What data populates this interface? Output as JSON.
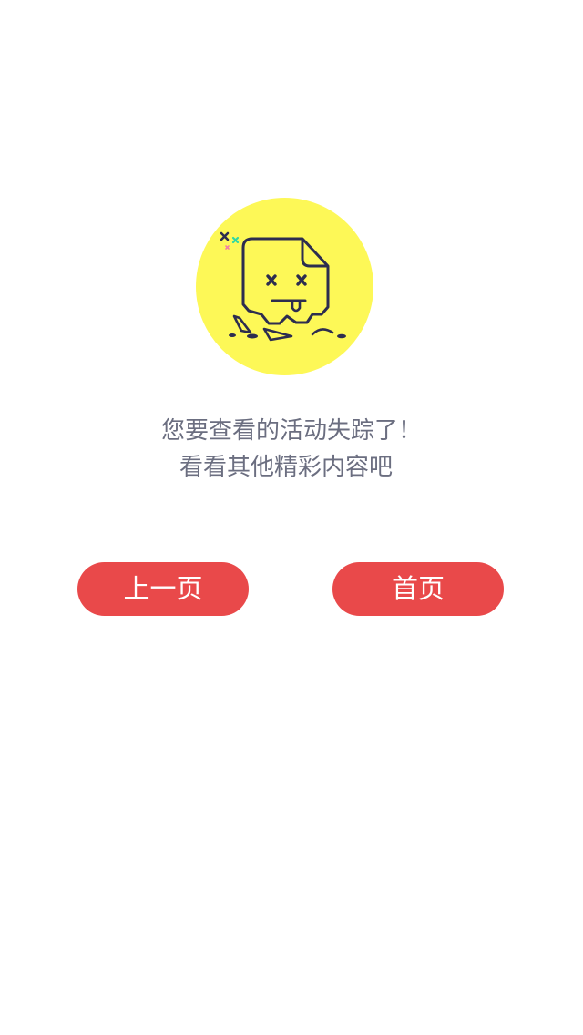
{
  "illustration": {
    "icon": "broken-page-icon",
    "circle_color": "#fdf857",
    "line_color": "#2d2d4f"
  },
  "message": {
    "line1": "您要查看的活动失踪了！",
    "line2": "看看其他精彩内容吧"
  },
  "buttons": {
    "prev_label": "上一页",
    "home_label": "首页",
    "color": "#e9494a"
  }
}
